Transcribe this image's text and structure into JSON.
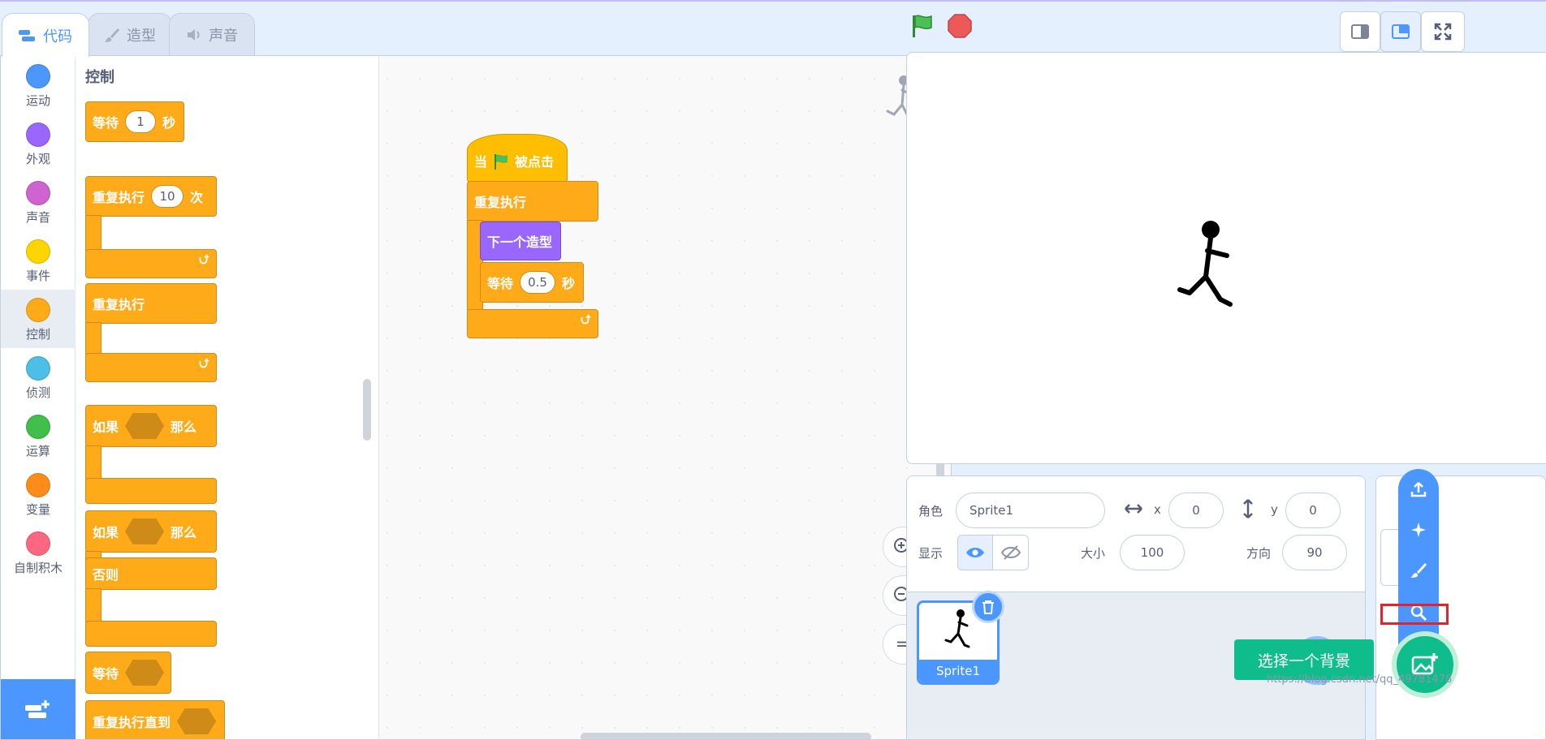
{
  "tabs": [
    {
      "label": "代码",
      "icon": "code-icon",
      "active": true
    },
    {
      "label": "造型",
      "icon": "brush-icon",
      "active": false
    },
    {
      "label": "声音",
      "icon": "speaker-icon",
      "active": false
    }
  ],
  "categories": [
    {
      "label": "运动",
      "color": "#4c97ff"
    },
    {
      "label": "外观",
      "color": "#9966ff"
    },
    {
      "label": "声音",
      "color": "#cf63cf"
    },
    {
      "label": "事件",
      "color": "#ffd500"
    },
    {
      "label": "控制",
      "color": "#ffab19",
      "selected": true
    },
    {
      "label": "侦测",
      "color": "#4cbfe6"
    },
    {
      "label": "运算",
      "color": "#40bf4a"
    },
    {
      "label": "变量",
      "color": "#ff8c1a"
    },
    {
      "label": "自制积木",
      "color": "#ff6680"
    }
  ],
  "palette": {
    "heading": "控制",
    "wait_label": "等待",
    "wait_value": "1",
    "wait_unit": "秒",
    "repeat_label": "重复执行",
    "repeat_value": "10",
    "repeat_unit": "次",
    "forever_label": "重复执行",
    "if_label": "如果",
    "then_label": "那么",
    "ifelse_label": "如果",
    "ifelse_then": "那么",
    "else_label": "否则",
    "wait_until_label": "等待",
    "repeat_until_label": "重复执行直到"
  },
  "script": {
    "when_label": "当",
    "clicked_label": "被点击",
    "forever_label": "重复执行",
    "next_costume_label": "下一个造型",
    "wait_label": "等待",
    "wait_value": "0.5",
    "wait_unit": "秒"
  },
  "zoom": {
    "reset_label": "="
  },
  "sprite_info": {
    "name_label": "角色",
    "name_value": "Sprite1",
    "x_label": "x",
    "x_value": "0",
    "y_label": "y",
    "y_value": "0",
    "show_label": "显示",
    "size_label": "大小",
    "size_value": "100",
    "direction_label": "方向",
    "direction_value": "90"
  },
  "sprite_list": [
    {
      "name": "Sprite1"
    }
  ],
  "backdrop": {
    "tooltip": "选择一个背景"
  },
  "watermark": "https://blog.csdn.net/qq_49781478"
}
